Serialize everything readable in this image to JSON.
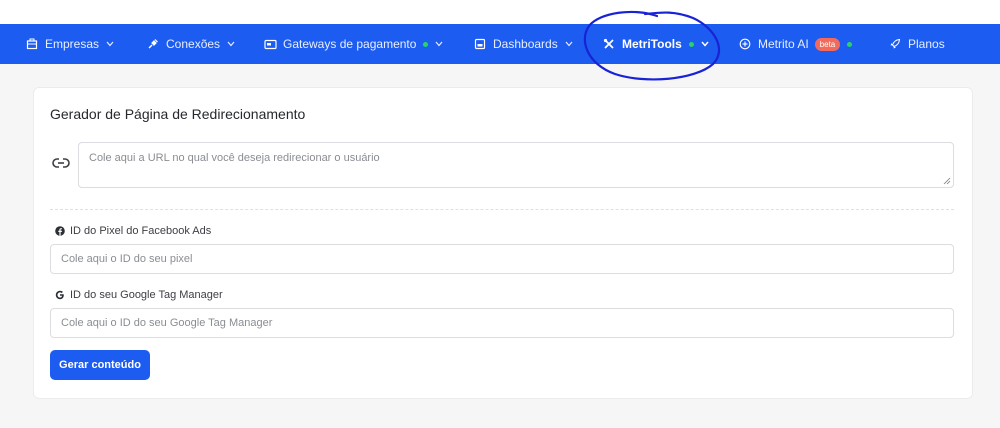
{
  "nav": {
    "items": [
      {
        "label": "Empresas",
        "icon": "building-icon"
      },
      {
        "label": "Conexões",
        "icon": "plug-icon"
      },
      {
        "label": "Gateways de pagamento",
        "icon": "wallet-icon"
      },
      {
        "label": "Dashboards",
        "icon": "dashboard-icon"
      },
      {
        "label": "MetriTools",
        "icon": "tools-icon"
      },
      {
        "label": "Metrito AI",
        "icon": "plus-circle-icon",
        "badge": "beta"
      },
      {
        "label": "Planos",
        "icon": "rocket-icon"
      }
    ],
    "active": "MetriTools",
    "status_dot_color": "#2ad36a",
    "bar_color": "#1c5cf0"
  },
  "card": {
    "title": "Gerador de Página de Redirecionamento",
    "url_placeholder": "Cole aqui a URL no qual você deseja redirecionar o usuário",
    "pixel_label": "ID do Pixel do Facebook Ads",
    "pixel_placeholder": "Cole aqui o ID do seu pixel",
    "gtm_label": "ID do seu Google Tag Manager",
    "gtm_placeholder": "Cole aqui o ID do seu Google Tag Manager",
    "submit_label": "Gerar conteúdo"
  },
  "annotation": {
    "color": "#1a22d6"
  }
}
